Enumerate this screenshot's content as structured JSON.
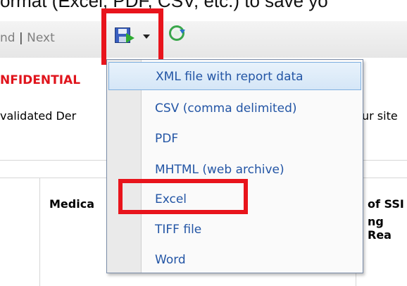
{
  "caption": {
    "text": "ormat (Excel, PDF, CSV, etc.) to save yo"
  },
  "toolbar": {
    "find_label": "nd",
    "separator": "|",
    "next_label": "Next",
    "save_icon": "floppy-save-icon",
    "refresh_icon": "refresh-icon"
  },
  "report": {
    "confidential": "NFIDENTIAL",
    "validated_left": "validated Der",
    "validated_right": "ur site",
    "col_medica": "Medica",
    "col_right_line1": "of SSI",
    "col_right_line2": "ng Rea"
  },
  "export_menu": {
    "items": [
      {
        "label": "XML file with report data"
      },
      {
        "label": "CSV (comma delimited)"
      },
      {
        "label": "PDF"
      },
      {
        "label": "MHTML (web archive)"
      },
      {
        "label": "Excel"
      },
      {
        "label": "TIFF file"
      },
      {
        "label": "Word"
      }
    ]
  },
  "colors": {
    "highlight_red": "#e8141c",
    "menu_text_blue": "#2355a5",
    "confidential_red": "#e0141c"
  }
}
